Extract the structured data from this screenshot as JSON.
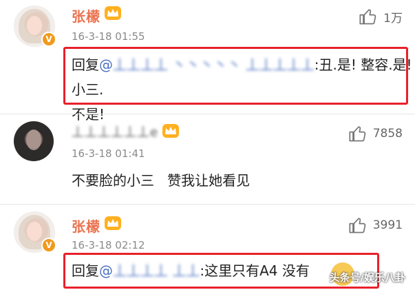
{
  "comments": [
    {
      "username": "张檬",
      "timestamp": "16-3-18 01:55",
      "likes": "1万",
      "reply_prefix": "回复",
      "mention_at": "@",
      "mention_blurred": "丄丄丄丄 丶丶丶丶丶 丄丄丄丄丄",
      "text_line1": ":丑.是! 整容.是! 小三.",
      "text_line2": "不是!"
    },
    {
      "username": "丄丄丄丄丄丄e",
      "timestamp": "16-3-18 01:41",
      "likes": "7858",
      "text": "不要脸的小三   赞我让她看见"
    },
    {
      "username": "张檬",
      "timestamp": "16-3-18 02:12",
      "likes": "3991",
      "reply_prefix": "回复",
      "mention_at": "@",
      "mention_blurred": "丄丄丄丄 丄丄",
      "text": ":这里只有A4 没有"
    }
  ],
  "watermark": "头条号/娱乐八卦",
  "colors": {
    "username": "#eb7350",
    "mention": "#4a70c0",
    "highlight_box": "#e8202a",
    "vip_badge": "#ffb020"
  }
}
